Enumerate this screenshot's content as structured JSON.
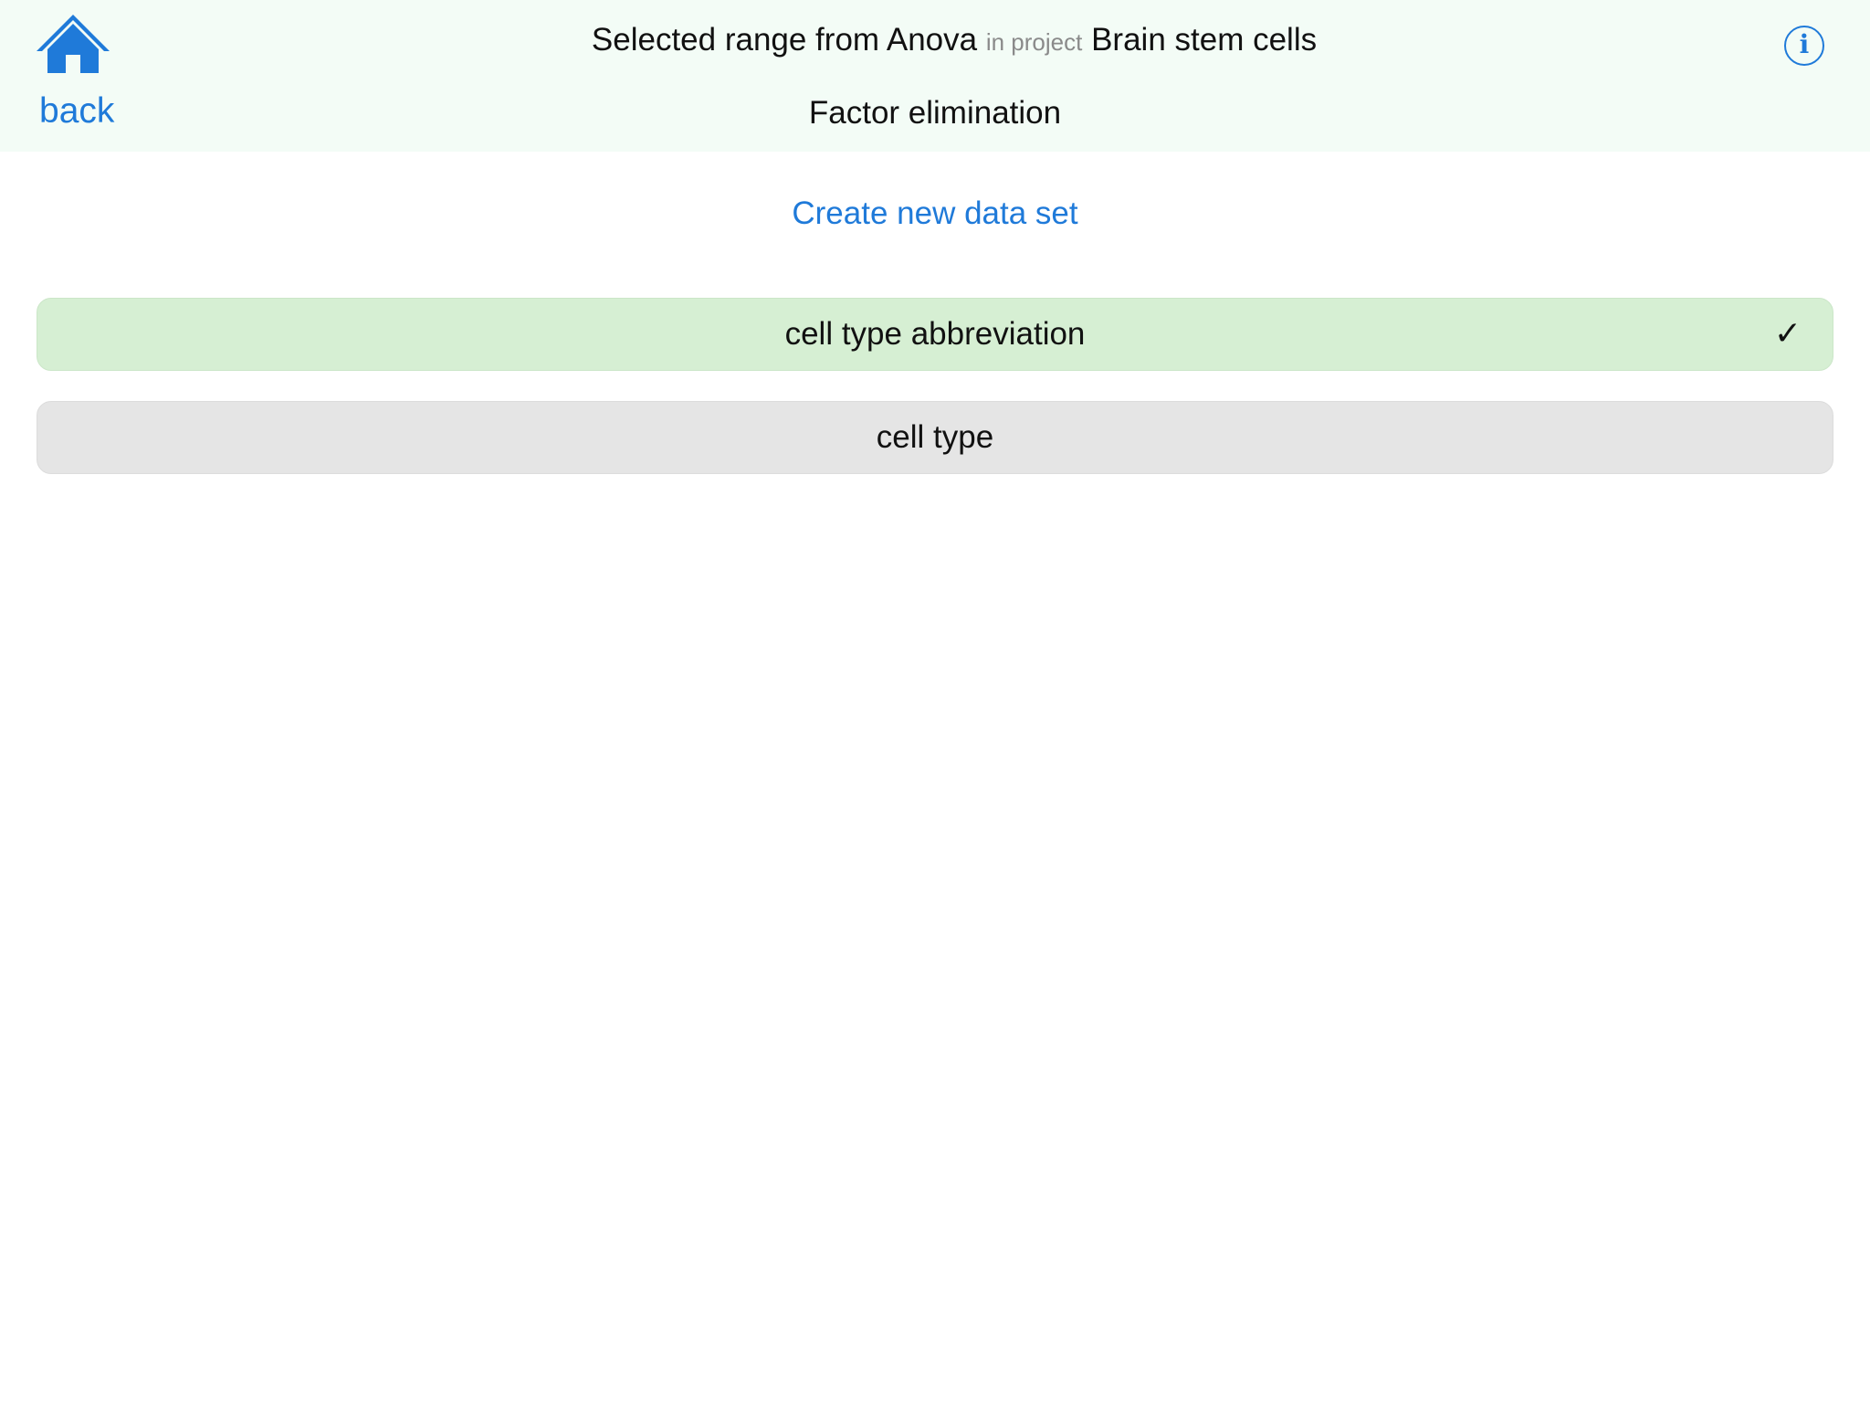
{
  "header": {
    "home_icon": "house-icon",
    "back_label": "back",
    "title_prefix": "Selected range from Anova",
    "title_connector": "in project",
    "title_project": "Brain stem cells",
    "subtitle": "Factor elimination",
    "info_icon": "info-icon",
    "info_glyph": "i"
  },
  "main": {
    "create_link": "Create new data set",
    "factors": [
      {
        "label": "cell type abbreviation",
        "selected": true,
        "mark": "✓"
      },
      {
        "label": "cell type",
        "selected": false
      }
    ]
  },
  "colors": {
    "accent": "#1f7ad9",
    "header_bg": "#f3fcf6",
    "selected_row": "#d6efd3",
    "unselected_row": "#e5e5e5"
  }
}
